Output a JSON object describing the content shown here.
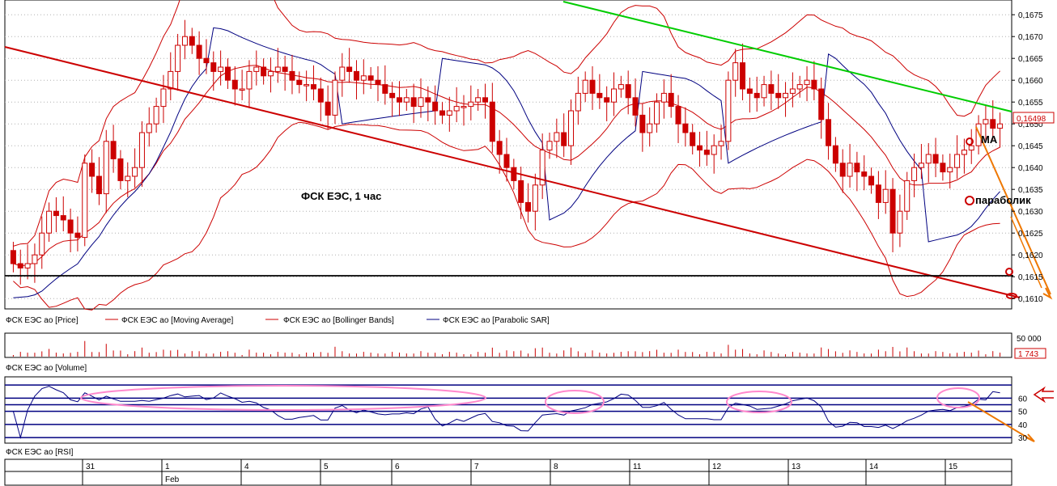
{
  "chart_data": {
    "type": "candlestick",
    "title": "ФСК ЕЭС,  1 час",
    "price_axis": {
      "ylim": [
        0.1608,
        0.1678
      ],
      "ticks": [
        "0,1675",
        "0,1670",
        "0,1665",
        "0,1660",
        "0,1655",
        "0,1650",
        "0,1645",
        "0,1640",
        "0,1635",
        "0,1630",
        "0,1625",
        "0,1620",
        "0,1615",
        "0,1610"
      ],
      "current_price": "0,16498",
      "grid": true
    },
    "legend": [
      {
        "label": "ФСК ЕЭС ао [Price]",
        "color": "#cc0000"
      },
      {
        "label": "ФСК ЕЭС ао [Moving Average]",
        "color": "#cc0000"
      },
      {
        "label": "ФСК ЕЭС ао [Bollinger Bands]",
        "color": "#cc0000"
      },
      {
        "label": "ФСК ЕЭС ао [Parabolic SAR]",
        "color": "#000080"
      }
    ],
    "annotations": {
      "ma_label": "MA",
      "sar_label": "параболик"
    },
    "price_series": {
      "close": [
        0.1618,
        0.1617,
        0.1618,
        0.162,
        0.1625,
        0.163,
        0.1629,
        0.1628,
        0.1625,
        0.1624,
        0.1641,
        0.1638,
        0.1634,
        0.1646,
        0.1642,
        0.1637,
        0.1638,
        0.164,
        0.1648,
        0.165,
        0.1654,
        0.1658,
        0.1662,
        0.1668,
        0.167,
        0.1668,
        0.1665,
        0.1664,
        0.1662,
        0.1663,
        0.166,
        0.1658,
        0.1658,
        0.1662,
        0.1663,
        0.1661,
        0.1662,
        0.1663,
        0.1662,
        0.166,
        0.1659,
        0.1659,
        0.1658,
        0.1655,
        0.1652,
        0.166,
        0.1663,
        0.1662,
        0.166,
        0.1661,
        0.166,
        0.1659,
        0.1657,
        0.1656,
        0.1655,
        0.1656,
        0.1654,
        0.1656,
        0.1655,
        0.1653,
        0.1652,
        0.1653,
        0.1654,
        0.1654,
        0.1655,
        0.1656,
        0.1655,
        0.1646,
        0.1643,
        0.164,
        0.1637,
        0.1632,
        0.163,
        0.1636,
        0.1644,
        0.1646,
        0.1648,
        0.1645,
        0.1653,
        0.1657,
        0.166,
        0.1657,
        0.1656,
        0.1655,
        0.1658,
        0.1659,
        0.1656,
        0.1652,
        0.1648,
        0.165,
        0.1655,
        0.1657,
        0.1654,
        0.165,
        0.1648,
        0.1645,
        0.1644,
        0.1643,
        0.1645,
        0.1646,
        0.166,
        0.1664,
        0.1658,
        0.1657,
        0.1656,
        0.1659,
        0.1657,
        0.1656,
        0.1657,
        0.1658,
        0.1659,
        0.166,
        0.1658,
        0.1651,
        0.1645,
        0.1641,
        0.1638,
        0.1641,
        0.1639,
        0.1638,
        0.1636,
        0.1632,
        0.1635,
        0.1625,
        0.163,
        0.1637,
        0.164,
        0.1641,
        0.1643,
        0.1641,
        0.1639,
        0.164,
        0.1643,
        0.1644,
        0.1645,
        0.165,
        0.1651,
        0.1649,
        0.165
      ],
      "volume_scale": [
        "50 000",
        "1 743"
      ]
    },
    "rsi": {
      "ticks": [
        "60",
        "50",
        "40",
        "30"
      ],
      "ylim": [
        27,
        75
      ],
      "levels": [
        70,
        60,
        55,
        50,
        40,
        30
      ]
    },
    "time_axis": {
      "top_labels": [
        "31",
        "1",
        "4",
        "5",
        "6",
        "7",
        "8",
        "11",
        "12",
        "13",
        "14",
        "15"
      ],
      "bottom_labels": [
        "Feb"
      ]
    },
    "panels": {
      "volume_label": "ФСК ЕЭС ао [Volume]",
      "rsi_label": "ФСК ЕЭС ао [RSI]"
    },
    "colors": {
      "candle": "#cc0000",
      "sar": "#000080",
      "trend_down": "#cc0000",
      "trend_upper": "#00cc00",
      "support": "#000000",
      "forecast_arrow": "#ee7700",
      "rsi_highlight": "#ff88cc"
    }
  }
}
